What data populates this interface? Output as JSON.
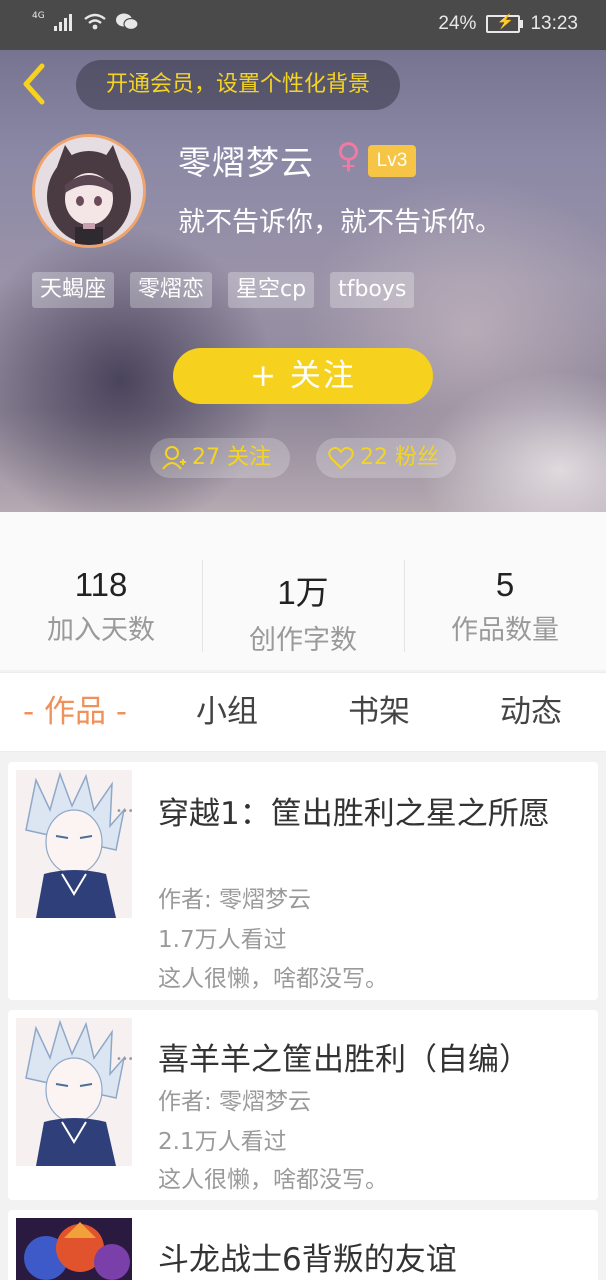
{
  "status_bar": {
    "network": "4G",
    "battery": "24%",
    "time": "13:23"
  },
  "header": {
    "vip_prompt": "开通会员，设置个性化背景",
    "user_name": "零熠梦云",
    "gender_symbol": "♀",
    "level": "Lv3",
    "signature": "就不告诉你，就不告诉你。",
    "tags": [
      "天蝎座",
      "零熠恋",
      "星空cp",
      "tfboys"
    ],
    "follow_button": "+  关注",
    "following_text": "27 关注",
    "followers_text": "22 粉丝"
  },
  "stats": [
    {
      "value": "118",
      "label": "加入天数"
    },
    {
      "value": "1万",
      "label": "创作字数"
    },
    {
      "value": "5",
      "label": "作品数量"
    }
  ],
  "tabs": [
    {
      "label": "- 作品 -",
      "active": true
    },
    {
      "label": "小组",
      "active": false
    },
    {
      "label": "书架",
      "active": false
    },
    {
      "label": "动态",
      "active": false
    }
  ],
  "works": [
    {
      "title": "穿越1：筐出胜利之星之所愿",
      "author": "作者: 零熠梦云",
      "views": "1.7万人看过",
      "intro": "这人很懒，啥都没写。"
    },
    {
      "title": "喜羊羊之筐出胜利（自编）",
      "author": "作者: 零熠梦云",
      "views": "2.1万人看过",
      "intro": "这人很懒，啥都没写。"
    },
    {
      "title": "斗龙战士6背叛的友谊"
    }
  ],
  "colors": {
    "accent_yellow": "#f6d21e",
    "tab_active": "#f0915c",
    "level_badge": "#f7c546",
    "gender_pink": "#f17aa2"
  }
}
